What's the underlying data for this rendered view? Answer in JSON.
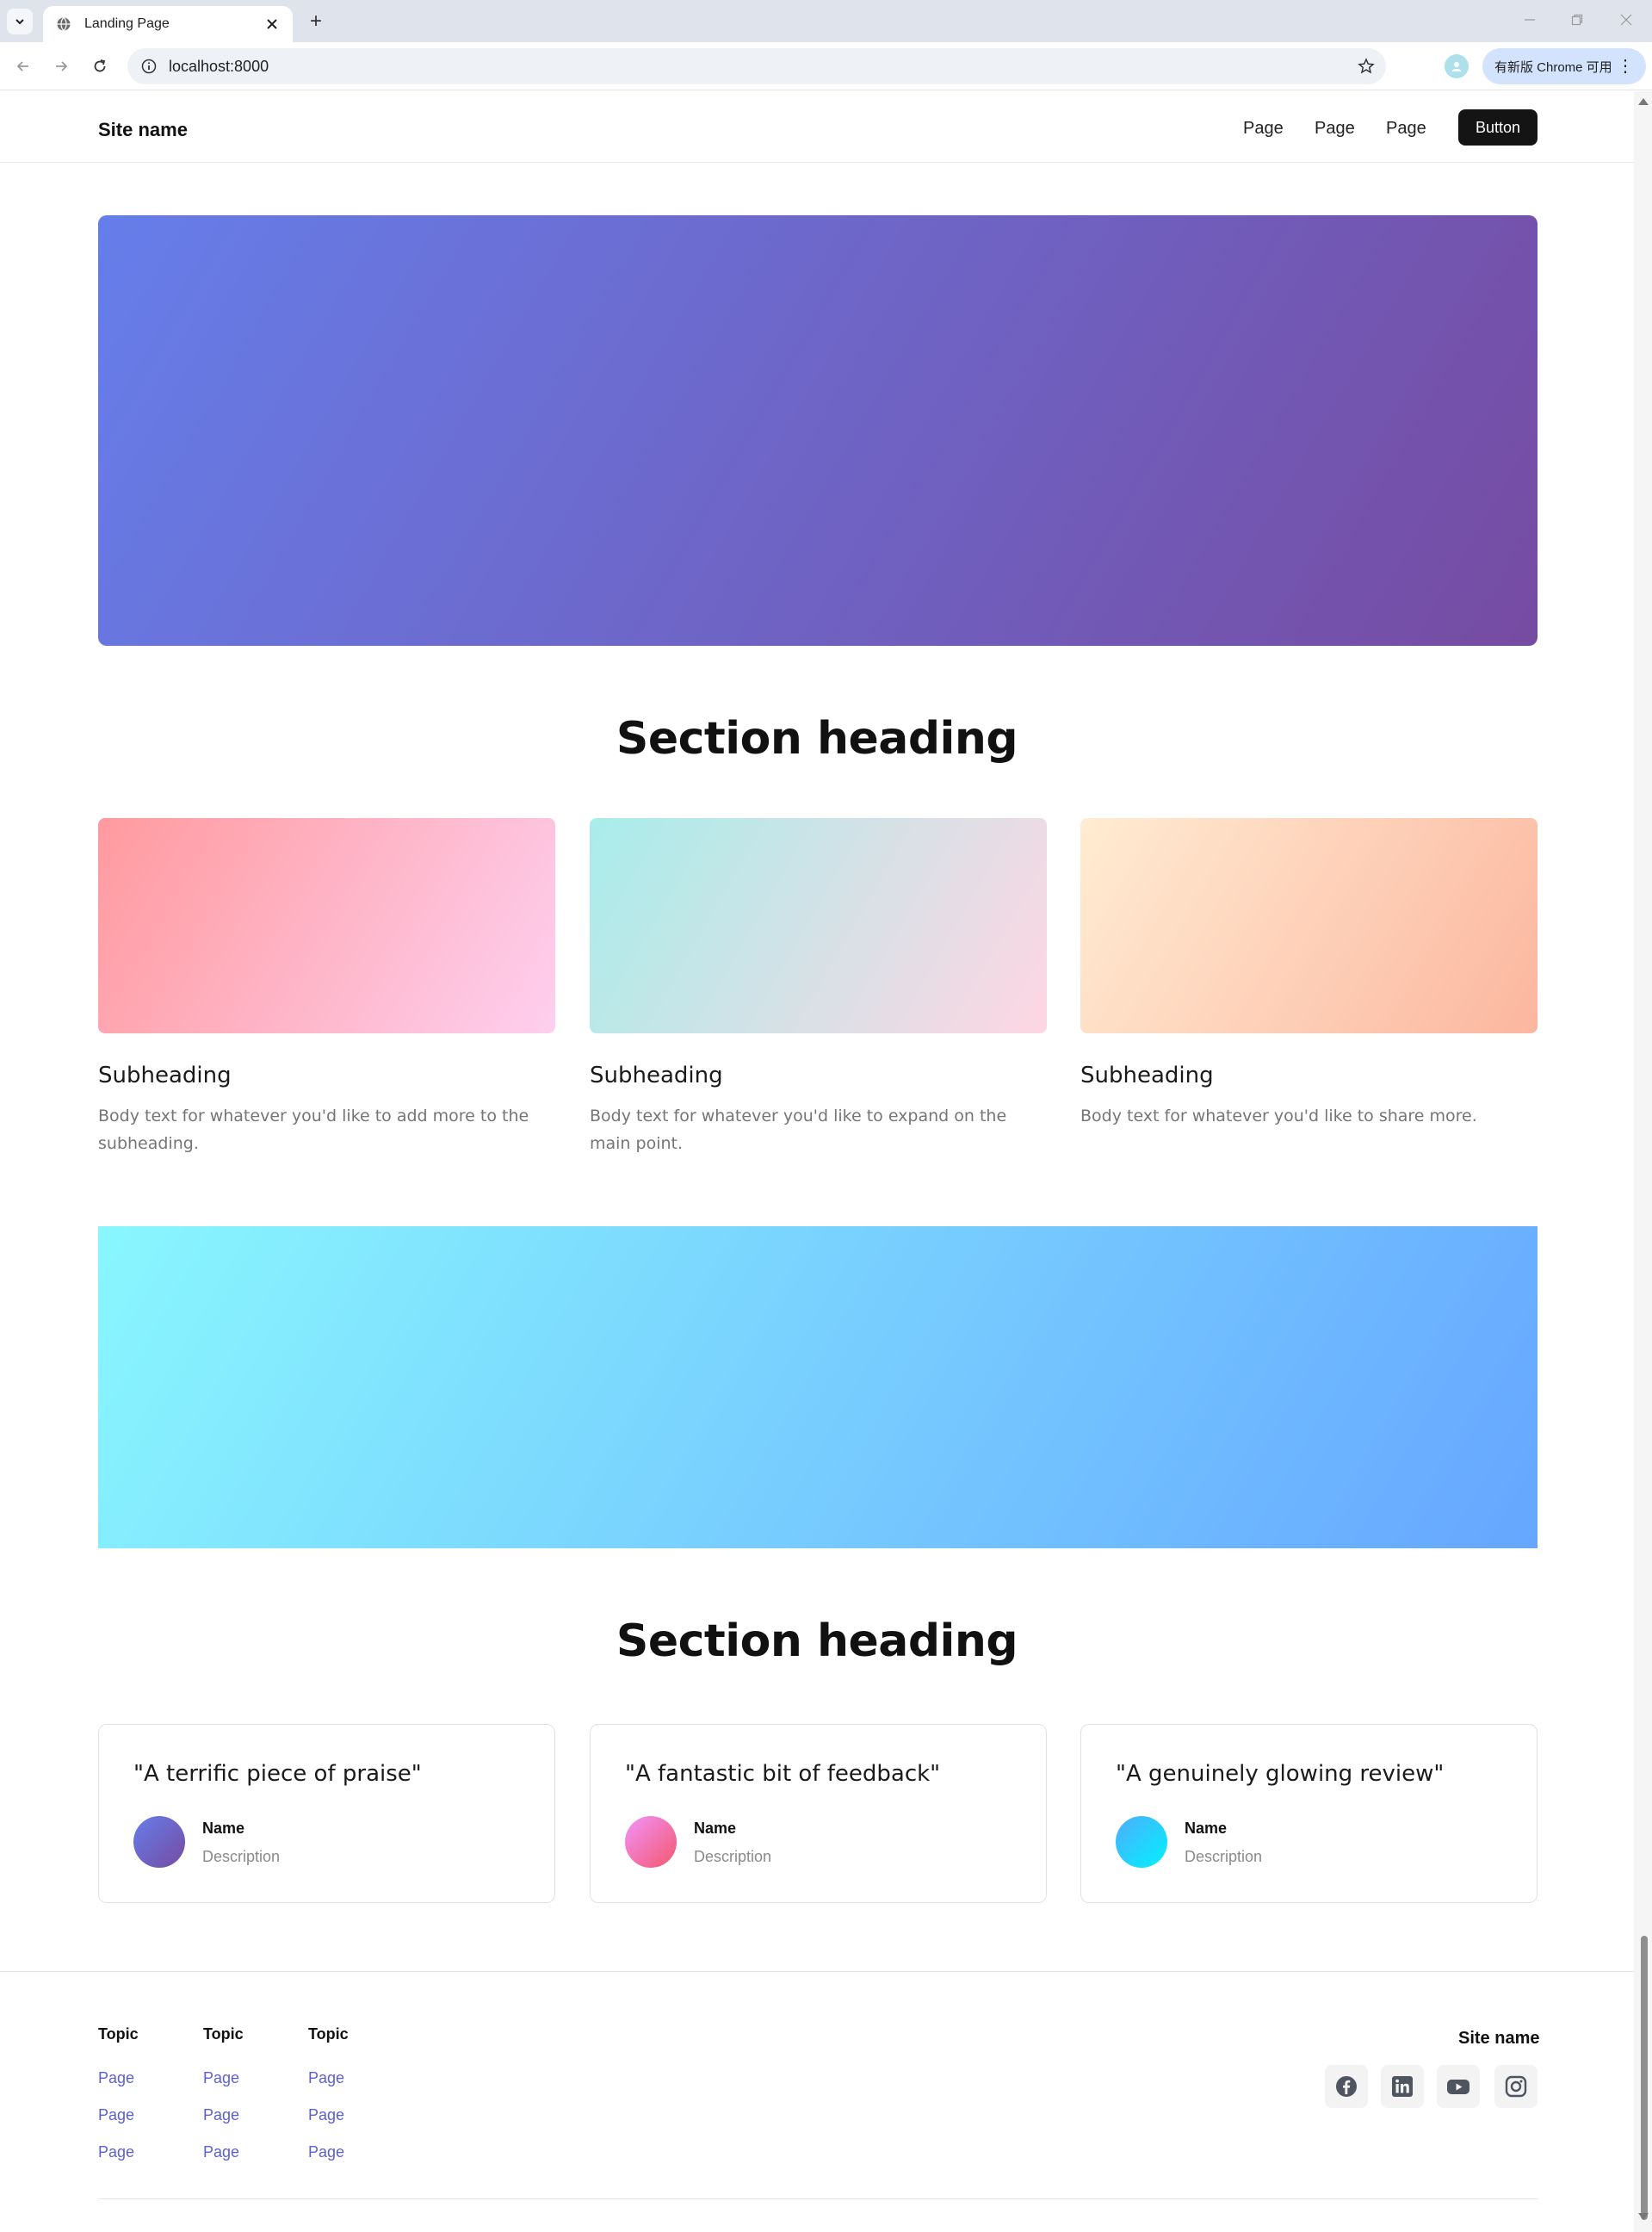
{
  "browser": {
    "tab_title": "Landing Page",
    "new_tab": "+",
    "url": "localhost:8000",
    "update_label": "有新版 Chrome 可用"
  },
  "header": {
    "site_name": "Site name",
    "nav": [
      "Page",
      "Page",
      "Page"
    ],
    "button": "Button"
  },
  "sections": {
    "features_heading": "Section heading",
    "testimonials_heading": "Section heading"
  },
  "features": [
    {
      "subheading": "Subheading",
      "body": "Body text for whatever you'd like to add more to the subheading."
    },
    {
      "subheading": "Subheading",
      "body": "Body text for whatever you'd like to expand on the main point."
    },
    {
      "subheading": "Subheading",
      "body": "Body text for whatever you'd like to share more."
    }
  ],
  "testimonials": [
    {
      "quote": "\"A terrific piece of praise\"",
      "name": "Name",
      "description": "Description"
    },
    {
      "quote": "\"A fantastic bit of feedback\"",
      "name": "Name",
      "description": "Description"
    },
    {
      "quote": "\"A genuinely glowing review\"",
      "name": "Name",
      "description": "Description"
    }
  ],
  "footer": {
    "site_name": "Site name",
    "columns": [
      {
        "topic": "Topic",
        "links": [
          "Page",
          "Page",
          "Page"
        ]
      },
      {
        "topic": "Topic",
        "links": [
          "Page",
          "Page",
          "Page"
        ]
      },
      {
        "topic": "Topic",
        "links": [
          "Page",
          "Page",
          "Page"
        ]
      }
    ],
    "social_icons": [
      "facebook-icon",
      "linkedin-icon",
      "youtube-icon",
      "instagram-icon"
    ]
  },
  "colors": {
    "hero_gradient": [
      "#667eea",
      "#764ba2"
    ],
    "feature_gradients": [
      [
        "#ff9a9e",
        "#fecfef"
      ],
      [
        "#a8edea",
        "#fed6e3"
      ],
      [
        "#ffecd2",
        "#fcb69f"
      ]
    ],
    "banner_gradient": [
      "#89f7fe",
      "#66a6ff"
    ],
    "avatar_gradients": [
      [
        "#667eea",
        "#764ba2"
      ],
      [
        "#f093fb",
        "#f5576c"
      ],
      [
        "#4facfe",
        "#00f2fe"
      ]
    ],
    "button_bg": "#141414",
    "footer_link": "#5b5fd6"
  }
}
